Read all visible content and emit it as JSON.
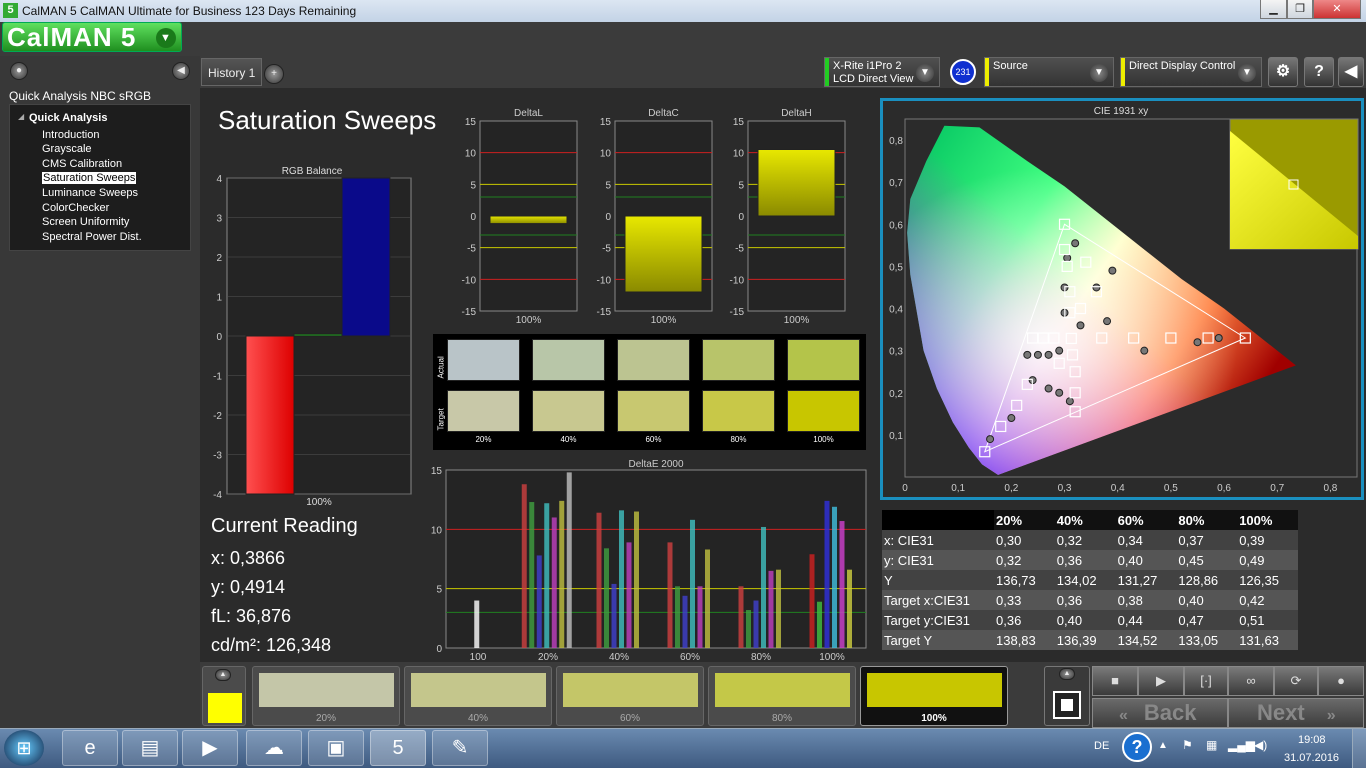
{
  "window": {
    "title": "CalMAN 5 CalMAN Ultimate for Business 123 Days Remaining",
    "icon_label": "5"
  },
  "logo": {
    "text": "CalMAN 5"
  },
  "sidebar": {
    "workflow_title": "Quick Analysis NBC sRGB",
    "root": "Quick Analysis",
    "items": [
      "Introduction",
      "Grayscale",
      "CMS Calibration",
      "Saturation Sweeps",
      "Luminance Sweeps",
      "ColorChecker",
      "Screen Uniformity",
      "Spectral Power Dist."
    ],
    "selected": "Saturation Sweeps"
  },
  "tabs": [
    {
      "label": "History 1"
    },
    {
      "label": "+"
    }
  ],
  "devices": {
    "meter": {
      "line1": "X-Rite i1Pro 2",
      "line2": "LCD Direct View",
      "badge": "231",
      "accent": "#22cc22"
    },
    "source": {
      "label": "Source",
      "accent": "#eeee00"
    },
    "display": {
      "label": "Direct Display Control",
      "accent": "#eeee00"
    }
  },
  "page_title": "Saturation Sweeps",
  "current_reading": {
    "title": "Current Reading",
    "x": "x: 0,3866",
    "y": "y: 0,4914",
    "fl": "fL: 36,876",
    "cdm2": "cd/m²: 126,348"
  },
  "chart_data": [
    {
      "type": "bar",
      "title": "RGB Balance",
      "categories": [
        "100%"
      ],
      "ylim": [
        -4,
        4
      ],
      "yticks": [
        "4",
        "3",
        "2",
        "1",
        "0",
        "-1",
        "-2",
        "-3",
        "-4"
      ],
      "series": [
        {
          "name": "R",
          "values": [
            -4
          ],
          "color": "#ff2020"
        },
        {
          "name": "G",
          "values": [
            0.05
          ],
          "color": "#20a020"
        },
        {
          "name": "B",
          "values": [
            4
          ],
          "color": "#0a0a8a"
        }
      ]
    },
    {
      "type": "bar",
      "title": "DeltaL",
      "categories": [
        "100%"
      ],
      "ylim": [
        -15,
        15
      ],
      "values": [
        -1.2
      ],
      "yticks": [
        "15",
        "10",
        "5",
        "0",
        "-5",
        "-10",
        "-15"
      ]
    },
    {
      "type": "bar",
      "title": "DeltaC",
      "categories": [
        "100%"
      ],
      "ylim": [
        -15,
        15
      ],
      "values": [
        -12
      ],
      "yticks": [
        "15",
        "10",
        "5",
        "0",
        "-5",
        "-10",
        "-15"
      ]
    },
    {
      "type": "bar",
      "title": "DeltaH",
      "categories": [
        "100%"
      ],
      "ylim": [
        -15,
        15
      ],
      "values": [
        10.5
      ],
      "yticks": [
        "15",
        "10",
        "5",
        "0",
        "-5",
        "-10",
        "-15"
      ]
    },
    {
      "type": "bar",
      "title": "DeltaE 2000",
      "categories": [
        "100",
        "20%",
        "40%",
        "60%",
        "80%",
        "100%"
      ],
      "ylim": [
        0,
        15
      ],
      "yticks": [
        "15",
        "10",
        "5",
        "0"
      ],
      "groups": [
        [
          4
        ],
        [
          13.8,
          12.3,
          7.8,
          12.2,
          11,
          12.4,
          14.8
        ],
        [
          11.4,
          8.4,
          5.4,
          11.6,
          8.9,
          11.5
        ],
        [
          8.9,
          5.2,
          4.4,
          10.8,
          5.2,
          8.3
        ],
        [
          5.2,
          3.2,
          4,
          10.2,
          6.5,
          6.6
        ],
        [
          7.9,
          3.9,
          12.4,
          11.9,
          10.7,
          6.6
        ]
      ]
    },
    {
      "type": "scatter",
      "title": "CIE 1931 xy",
      "xlim": [
        0,
        0.85
      ],
      "ylim": [
        0,
        0.85
      ],
      "xticks": [
        "0",
        "0,1",
        "0,2",
        "0,3",
        "0,4",
        "0,5",
        "0,6",
        "0,7",
        "0,8"
      ],
      "yticks": [
        "0,1",
        "0,2",
        "0,3",
        "0,4",
        "0,5",
        "0,6",
        "0,7",
        "0,8"
      ],
      "targets": [
        [
          0.64,
          0.33
        ],
        [
          0.3,
          0.6
        ],
        [
          0.15,
          0.06
        ],
        [
          0.3127,
          0.329
        ],
        [
          0.57,
          0.33
        ],
        [
          0.5,
          0.33
        ],
        [
          0.43,
          0.33
        ],
        [
          0.37,
          0.33
        ],
        [
          0.3,
          0.54
        ],
        [
          0.305,
          0.5
        ],
        [
          0.31,
          0.44
        ],
        [
          0.31,
          0.39
        ],
        [
          0.34,
          0.51
        ],
        [
          0.36,
          0.44
        ],
        [
          0.33,
          0.4
        ],
        [
          0.24,
          0.33
        ],
        [
          0.26,
          0.33
        ],
        [
          0.28,
          0.33
        ],
        [
          0.29,
          0.27
        ],
        [
          0.18,
          0.12
        ],
        [
          0.21,
          0.17
        ],
        [
          0.23,
          0.22
        ],
        [
          0.315,
          0.29
        ],
        [
          0.32,
          0.25
        ],
        [
          0.32,
          0.2
        ],
        [
          0.32,
          0.155
        ]
      ],
      "actuals": [
        [
          0.59,
          0.33
        ],
        [
          0.55,
          0.32
        ],
        [
          0.45,
          0.3
        ],
        [
          0.38,
          0.37
        ],
        [
          0.32,
          0.555
        ],
        [
          0.305,
          0.52
        ],
        [
          0.3,
          0.45
        ],
        [
          0.3,
          0.39
        ],
        [
          0.39,
          0.49
        ],
        [
          0.36,
          0.45
        ],
        [
          0.33,
          0.36
        ],
        [
          0.23,
          0.29
        ],
        [
          0.25,
          0.29
        ],
        [
          0.27,
          0.29
        ],
        [
          0.29,
          0.3
        ],
        [
          0.16,
          0.09
        ],
        [
          0.2,
          0.14
        ],
        [
          0.24,
          0.23
        ],
        [
          0.27,
          0.21
        ],
        [
          0.29,
          0.2
        ],
        [
          0.31,
          0.18
        ]
      ]
    }
  ],
  "swatches": {
    "row_labels": [
      "Actual",
      "Target"
    ],
    "columns": [
      "20%",
      "40%",
      "60%",
      "80%",
      "100%"
    ],
    "actual": [
      "#b9c4c8",
      "#b8c6a8",
      "#bcc491",
      "#b8c46a",
      "#b4c44a"
    ],
    "target": [
      "#c8c8a8",
      "#c8c890",
      "#c8c870",
      "#c8c848",
      "#c8c600"
    ]
  },
  "table": {
    "headers": [
      "",
      "20%",
      "40%",
      "60%",
      "80%",
      "100%"
    ],
    "rows": [
      {
        "label": "x: CIE31",
        "values": [
          "0,30",
          "0,32",
          "0,34",
          "0,37",
          "0,39"
        ]
      },
      {
        "label": "y: CIE31",
        "values": [
          "0,32",
          "0,36",
          "0,40",
          "0,45",
          "0,49"
        ]
      },
      {
        "label": "Y",
        "values": [
          "136,73",
          "134,02",
          "131,27",
          "128,86",
          "126,35"
        ]
      },
      {
        "label": "Target x:CIE31",
        "values": [
          "0,33",
          "0,36",
          "0,38",
          "0,40",
          "0,42"
        ]
      },
      {
        "label": "Target y:CIE31",
        "values": [
          "0,36",
          "0,40",
          "0,44",
          "0,47",
          "0,51"
        ]
      },
      {
        "label": "Target Y",
        "values": [
          "138,83",
          "136,39",
          "134,52",
          "133,05",
          "131,63"
        ]
      }
    ]
  },
  "bottom_patches": [
    {
      "label": "20%",
      "color": "#c4c6a8"
    },
    {
      "label": "40%",
      "color": "#c4c68c"
    },
    {
      "label": "60%",
      "color": "#c4c668"
    },
    {
      "label": "80%",
      "color": "#c4c848"
    },
    {
      "label": "100%",
      "color": "#c8c600"
    }
  ],
  "current_swatch_color": "#ffff00",
  "nav": {
    "back": "Back",
    "next": "Next"
  },
  "taskbar": {
    "lang": "DE",
    "time": "19:08",
    "date": "31.07.2016"
  }
}
